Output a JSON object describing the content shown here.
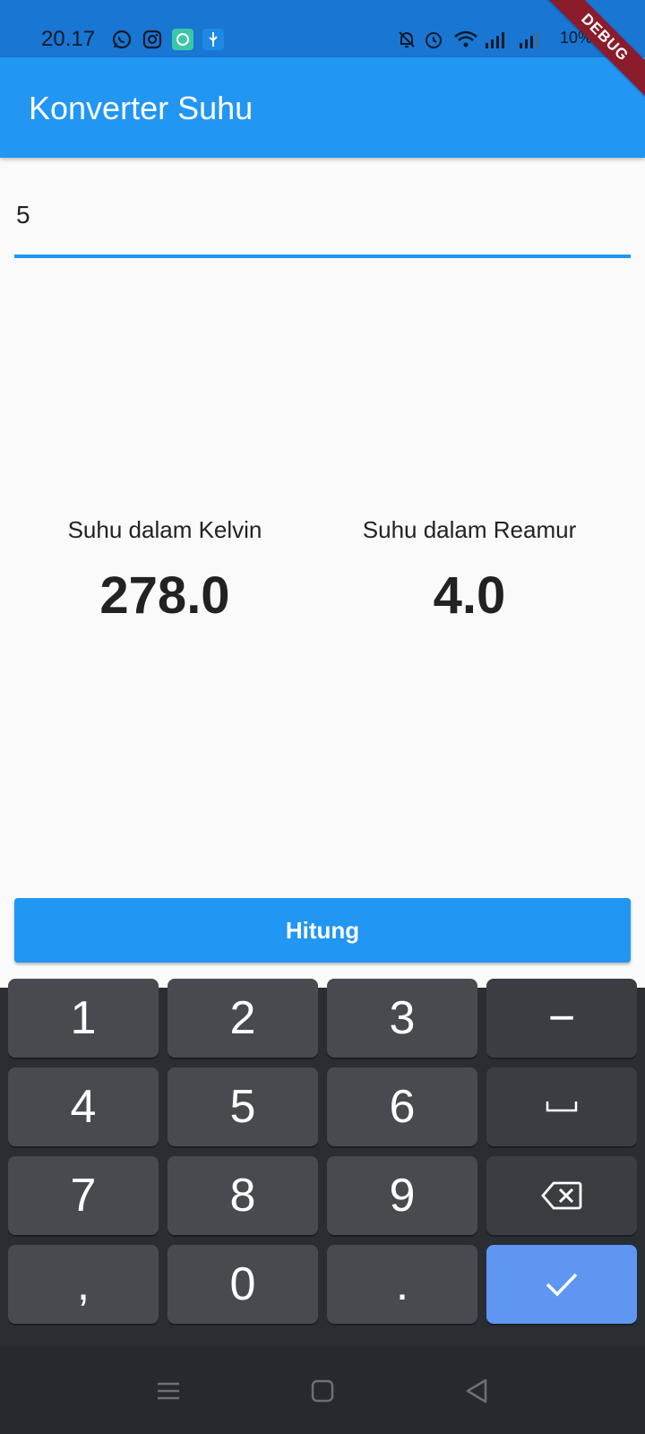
{
  "status_bar": {
    "time": "20.17",
    "battery": "10%",
    "icons": [
      "whatsapp-icon",
      "instagram-icon",
      "app-icon",
      "usb-icon",
      "mute-icon",
      "alarm-icon",
      "wifi-icon",
      "signal-icon",
      "signal-icon-2",
      "battery-icon"
    ]
  },
  "debug_banner": "DEBUG",
  "app_bar": {
    "title": "Konverter Suhu"
  },
  "input": {
    "value": "5"
  },
  "results": {
    "kelvin": {
      "label": "Suhu dalam Kelvin",
      "value": "278.0"
    },
    "reamur": {
      "label": "Suhu dalam Reamur",
      "value": "4.0"
    }
  },
  "button": {
    "label": "Hitung"
  },
  "keyboard": {
    "keys": [
      "1",
      "2",
      "3",
      "−",
      "4",
      "5",
      "6",
      "␣",
      "7",
      "8",
      "9",
      "backspace",
      ",",
      "0",
      ".",
      "enter"
    ]
  },
  "colors": {
    "primary": "#2196f3",
    "status_bar": "#1976d2",
    "keyboard_bg": "#2a2e33",
    "enter_key": "#5e96f2"
  }
}
